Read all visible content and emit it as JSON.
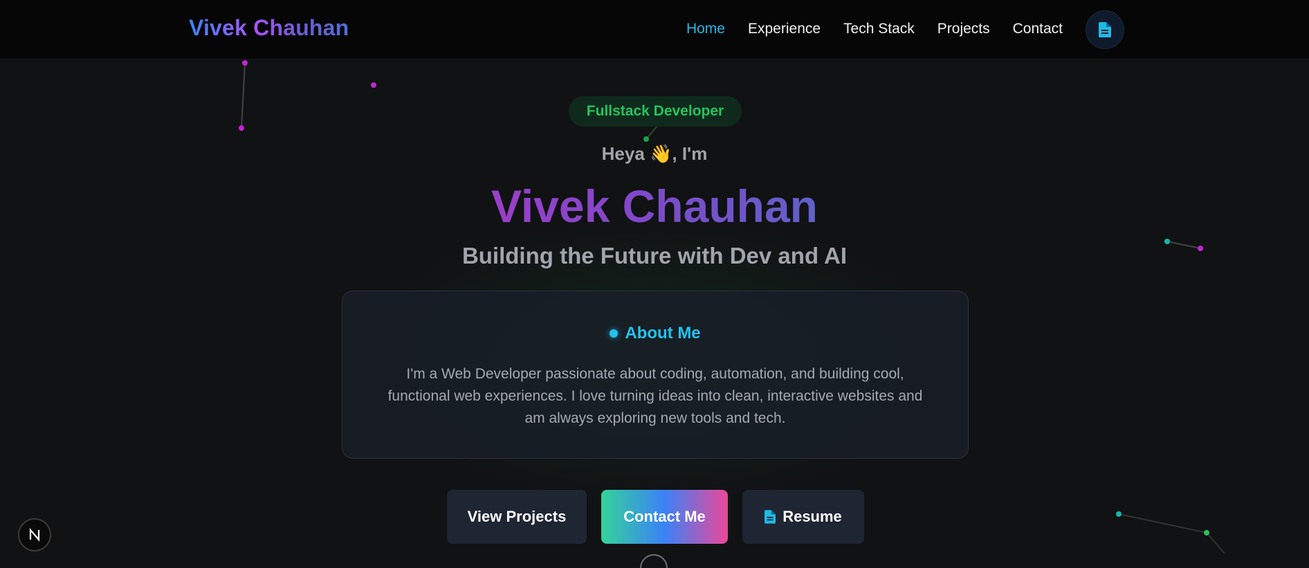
{
  "navbar": {
    "brand": "Vivek Chauhan",
    "links": [
      {
        "label": "Home",
        "active": true
      },
      {
        "label": "Experience",
        "active": false
      },
      {
        "label": "Tech Stack",
        "active": false
      },
      {
        "label": "Projects",
        "active": false
      },
      {
        "label": "Contact",
        "active": false
      }
    ],
    "resume_icon": "document-icon"
  },
  "hero": {
    "badge": "Fullstack Developer",
    "greeting": "Heya 👋, I'm",
    "name": "Vivek Chauhan",
    "tagline": "Building the Future with Dev and AI"
  },
  "about": {
    "title": "About Me",
    "text": "I'm a Web Developer passionate about coding, automation, and building cool, functional web experiences. I love turning ideas into clean, interactive websites and am always exploring new tools and tech."
  },
  "buttons": {
    "view_projects": "View Projects",
    "contact_me": "Contact Me",
    "resume": "Resume"
  },
  "colors": {
    "background": "#111214",
    "navbar": "#060606",
    "accent_cyan": "#22b8e6",
    "accent_green": "#22c55e",
    "accent_purple": "#9a3fc9",
    "button_dark": "#1e2533"
  },
  "icons": {
    "nav_resume": "document-icon",
    "resume_button": "document-icon",
    "corner_badge": "nextjs-logo-icon",
    "scroll": "scroll-down-icon"
  }
}
